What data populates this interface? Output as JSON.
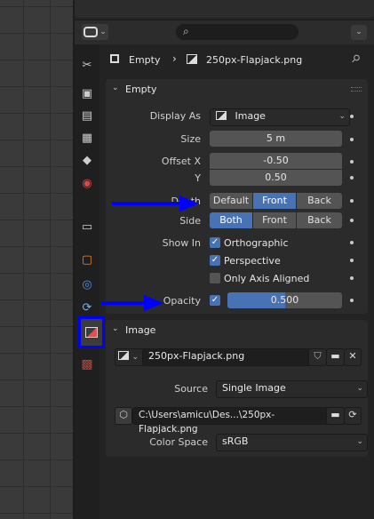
{
  "header": {
    "search_placeholder": "",
    "breadcrumb_object": "Empty",
    "breadcrumb_data": "250px-Flapjack.png"
  },
  "empty_panel": {
    "title": "Empty",
    "display_as_label": "Display As",
    "display_as_value": "Image",
    "size_label": "Size",
    "size_value": "5 m",
    "offset_x_label": "Offset X",
    "offset_x_value": "-0.50",
    "y_label": "Y",
    "y_value": "0.50",
    "depth_label": "Depth",
    "depth_options": [
      "Default",
      "Front",
      "Back"
    ],
    "depth_selected": "Front",
    "side_label": "Side",
    "side_options": [
      "Both",
      "Front",
      "Back"
    ],
    "side_selected": "Both",
    "show_in_label": "Show In",
    "orthographic_label": "Orthographic",
    "orthographic_checked": true,
    "perspective_label": "Perspective",
    "perspective_checked": true,
    "axis_aligned_label": "Only Axis Aligned",
    "axis_aligned_checked": false,
    "opacity_label": "Opacity",
    "opacity_checked": true,
    "opacity_value": "0.500",
    "opacity_fraction": 0.5
  },
  "image_panel": {
    "title": "Image",
    "image_name": "250px-Flapjack.png",
    "source_label": "Source",
    "source_value": "Single Image",
    "filepath": "C:\\Users\\amicu\\Des...\\250px-Flapjack.png",
    "color_space_label": "Color Space",
    "color_space_value": "sRGB"
  },
  "annotations": {
    "arrow_color": "#0000ff",
    "highlight_color": "#0000ff"
  },
  "colors": {
    "accent": "#4772b3",
    "panel": "#2b2b2b",
    "field": "#545454"
  }
}
